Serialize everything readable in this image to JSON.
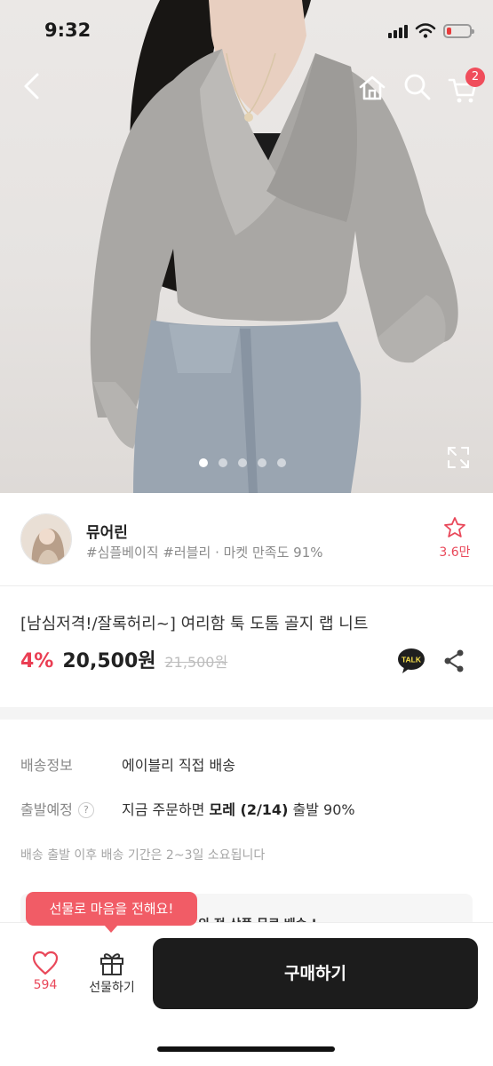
{
  "status_bar": {
    "time": "9:32"
  },
  "header": {
    "cart_count": "2"
  },
  "gallery": {
    "total_images": 5,
    "active_index": 0
  },
  "seller": {
    "name": "뮤어린",
    "tags": "#심플베이직 #러블리 · 마켓 만족도 91%",
    "favorite_count": "3.6만"
  },
  "product": {
    "title": "[남심저격!/잘록허리~] 여리함 툭 도톰 골지 랩 니트",
    "discount": "4%",
    "price": "20,500원",
    "original_price": "21,500원"
  },
  "shipping": {
    "info_label": "배송정보",
    "info_value": "에이블리 직접 배송",
    "departure_label": "출발예정",
    "help_mark": "?",
    "departure_prefix": "지금 주문하면",
    "departure_day": "모레 (2/14)",
    "departure_suffix": "출발 90%",
    "note": "배송 출발 이후 배송 기간은 2~3일 소요됩니다",
    "promo_partial": "의 전 상품 무료 배송 !"
  },
  "bottom_bar": {
    "like_count": "594",
    "gift_label": "선물하기",
    "buy_label": "구매하기",
    "gift_tooltip": "선물로 마음을 전해요!"
  },
  "colors": {
    "accent": "#ea3e53",
    "badge": "#f04d5b",
    "tooltip": "#f15c66",
    "buy_button": "#1c1c1c"
  },
  "icons": [
    "back-icon",
    "home-icon",
    "search-icon",
    "cart-icon",
    "expand-icon",
    "star-icon",
    "kakao-talk-icon",
    "share-icon",
    "heart-icon",
    "gift-icon"
  ]
}
